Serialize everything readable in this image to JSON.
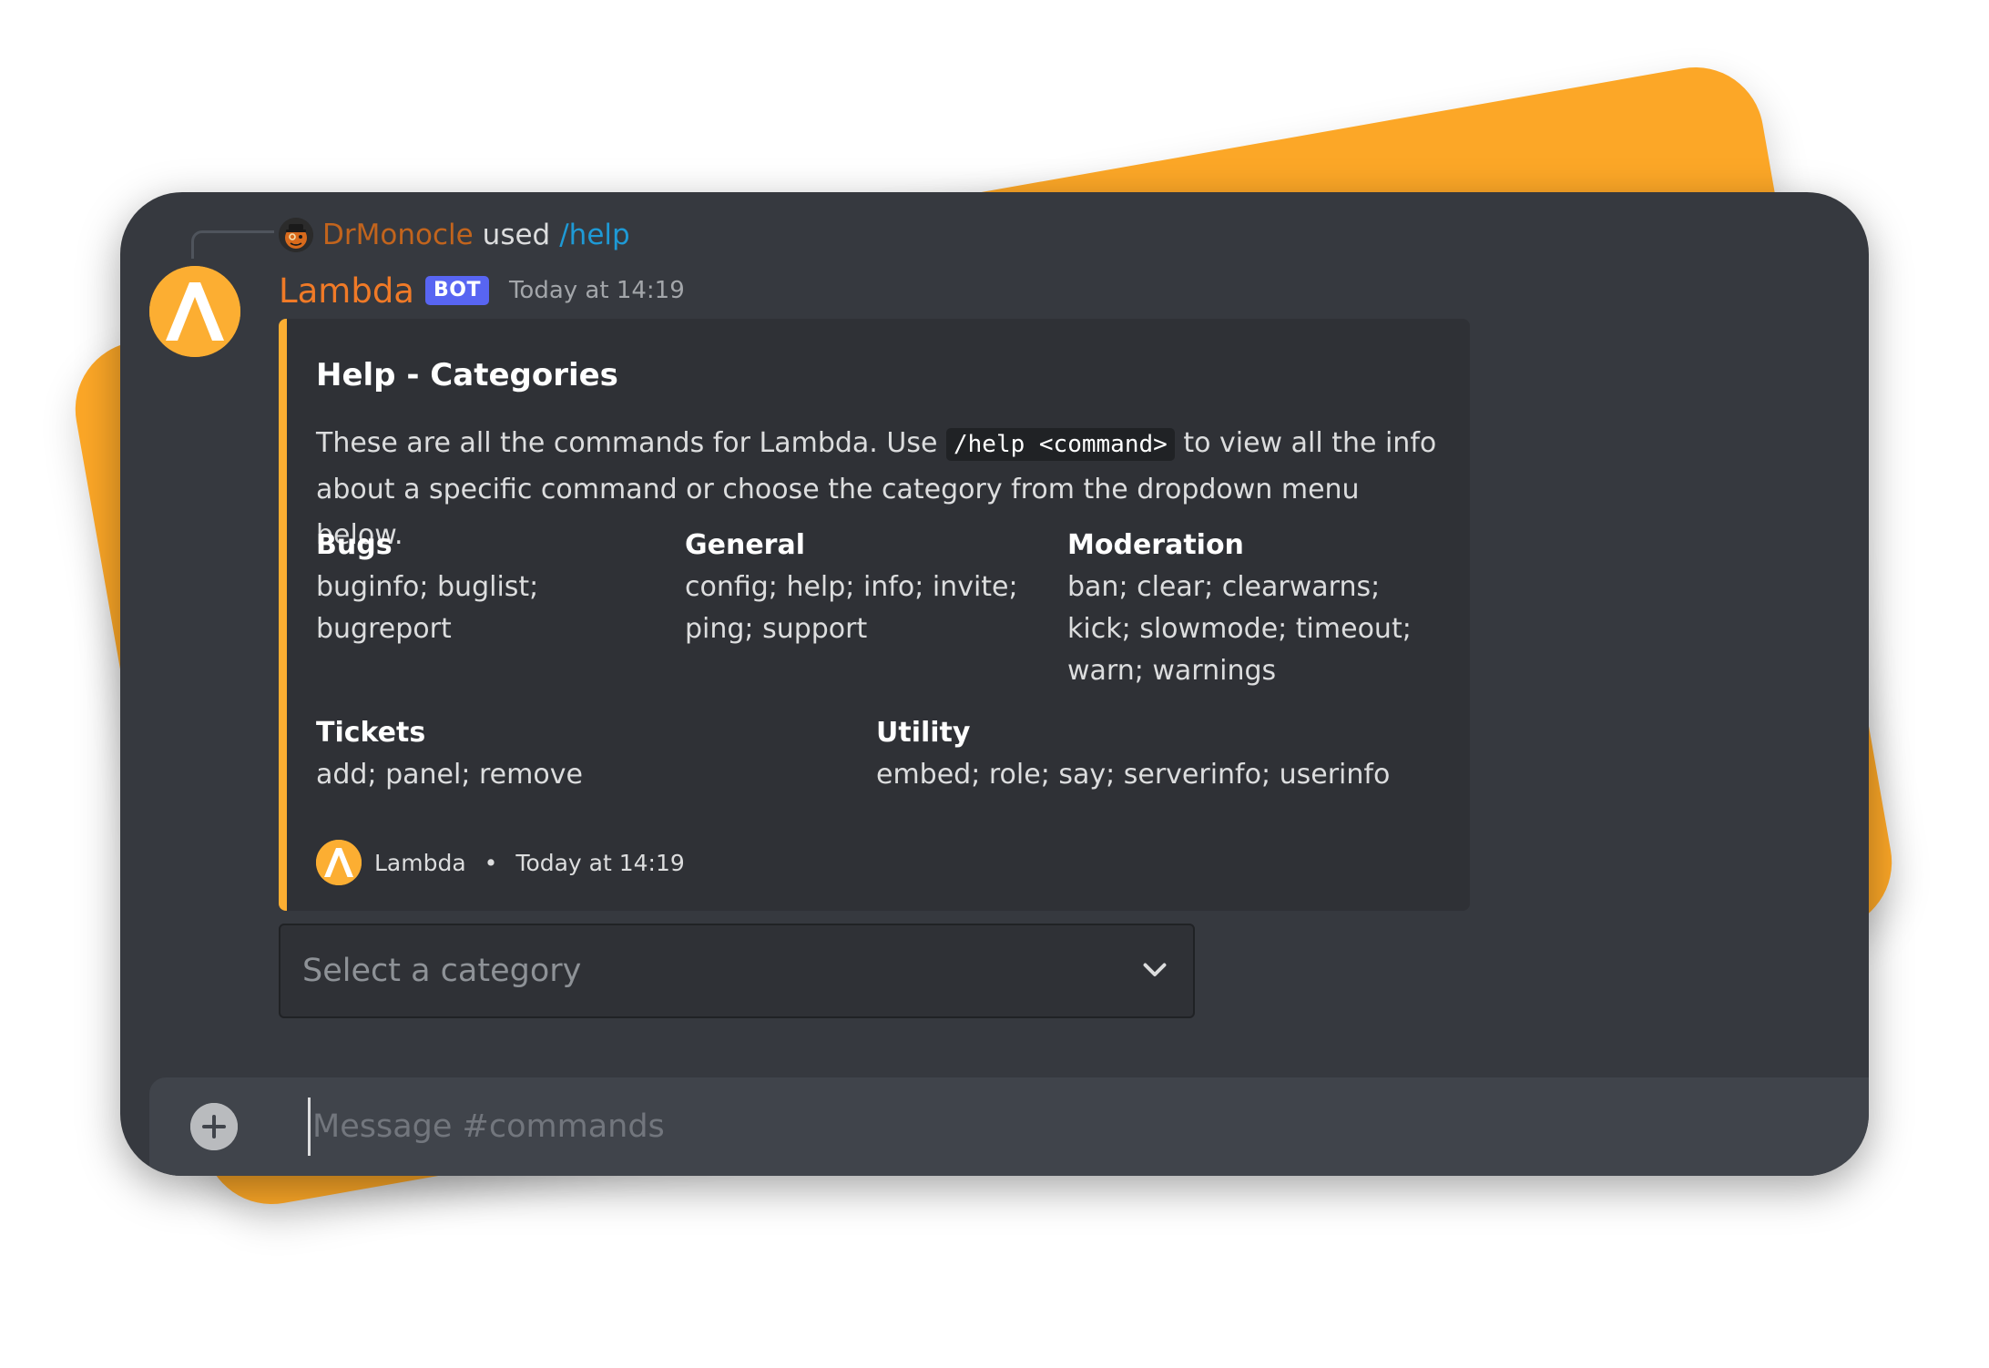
{
  "reply": {
    "username": "DrMonocle",
    "used_text": "used",
    "command": "/help"
  },
  "message": {
    "author": "Lambda",
    "bot_tag": "BOT",
    "timestamp": "Today at 14:19"
  },
  "embed": {
    "accent_color": "#fcae32",
    "title": "Help - Categories",
    "description_before": "These are all the commands for Lambda. Use",
    "description_code": "/help <command>",
    "description_after": "to view all the info about a specific command or choose the category from the dropdown menu below.",
    "fields": [
      {
        "name": "Bugs",
        "value": "buginfo; buglist; bugreport"
      },
      {
        "name": "General",
        "value": "config; help; info; invite; ping; support"
      },
      {
        "name": "Moderation",
        "value": "ban; clear; clearwarns; kick; slowmode; timeout; warn; warnings"
      },
      {
        "name": "Tickets",
        "value": "add; panel; remove"
      },
      {
        "name": "Utility",
        "value": "embed; role; say; serverinfo; userinfo"
      }
    ],
    "footer": {
      "text": "Lambda",
      "separator": "•",
      "timestamp": "Today at 14:19"
    }
  },
  "dropdown": {
    "placeholder": "Select a category",
    "icon": "chevron-down-icon"
  },
  "composer": {
    "placeholder": "Message #commands",
    "attach_icon": "plus-circle-icon"
  },
  "colors": {
    "background_card": "#fca727",
    "window_bg": "#36393f",
    "embed_bg": "#2f3136",
    "author_color": "#f07a27",
    "bot_tag_color": "#5865f2",
    "command_color": "#1e9ad6"
  }
}
